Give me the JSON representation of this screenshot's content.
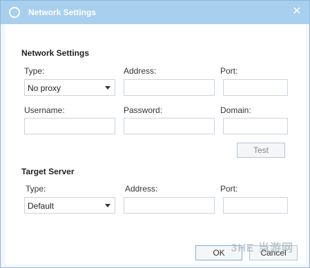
{
  "window": {
    "title": "Network Settings"
  },
  "network": {
    "section_title": "Network Settings",
    "type_label": "Type:",
    "type_value": "No proxy",
    "address_label": "Address:",
    "address_value": "",
    "port_label": "Port:",
    "port_value": "",
    "username_label": "Username:",
    "username_value": "",
    "password_label": "Password:",
    "password_value": "",
    "domain_label": "Domain:",
    "domain_value": "",
    "test_label": "Test"
  },
  "target": {
    "section_title": "Target Server",
    "type_label": "Type:",
    "type_value": "Default",
    "address_label": "Address:",
    "address_value": "",
    "port_label": "Port:",
    "port_value": ""
  },
  "buttons": {
    "ok": "OK",
    "cancel": "Cancel"
  },
  "watermark": "3HE 当游网"
}
